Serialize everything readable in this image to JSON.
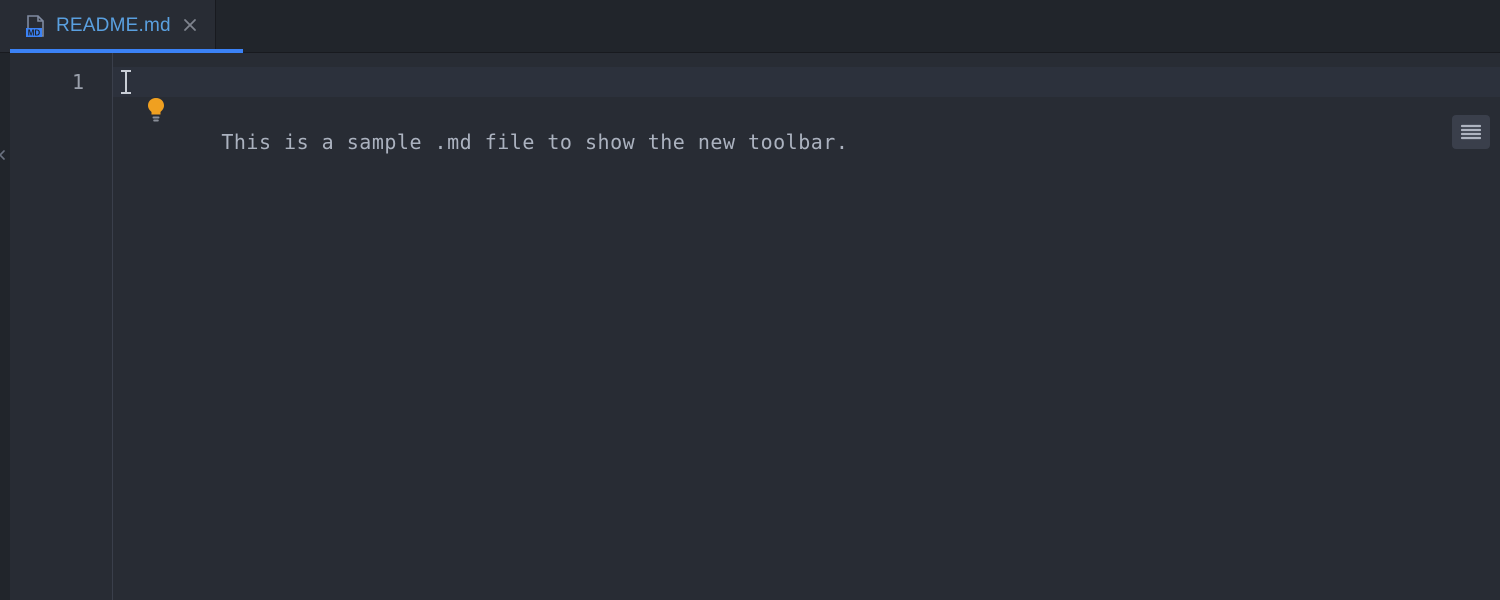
{
  "tab": {
    "title": "README.md",
    "icon_label": "MD",
    "active": true
  },
  "editor": {
    "lines": [
      {
        "number": "1",
        "text": "This is a sample .md file to show the new toolbar.",
        "current": true
      }
    ],
    "cursor_line": 1,
    "cursor_col": 1
  },
  "icons": {
    "bulb": "lightbulb-icon",
    "toolbar_button": "text-align-icon"
  }
}
